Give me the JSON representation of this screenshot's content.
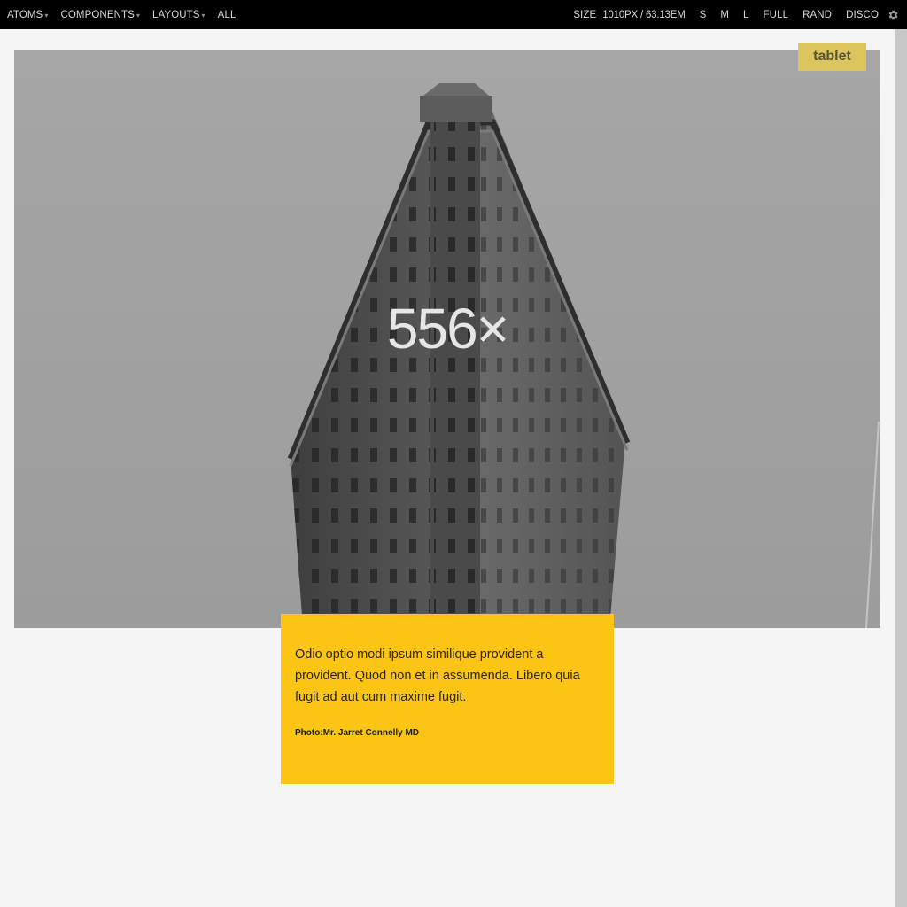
{
  "toolbar": {
    "nav": [
      {
        "label": "ATOMS",
        "caret": "▾"
      },
      {
        "label": "COMPONENTS",
        "caret": "▾"
      },
      {
        "label": "LAYOUTS",
        "caret": "▾"
      },
      {
        "label": "ALL",
        "caret": ""
      }
    ],
    "size_label": "SIZE",
    "size_value": "1010PX /  63.13EM",
    "size_buttons": [
      "S",
      "M",
      "L",
      "FULL",
      "RAND",
      "DISCO"
    ],
    "settings_icon": "gear-icon"
  },
  "viewport": {
    "breakpoint_badge": "tablet",
    "hero": {
      "placeholder_text": "556×",
      "image": "flatiron-building-photo"
    },
    "caption": {
      "body": "Odio optio modi ipsum similique provident a provident. Quod non et in assumenda. Libero quia fugit ad aut cum maxime fugit.",
      "credit": "Photo:Mr. Jarret Connelly MD"
    }
  },
  "colors": {
    "toolbar_bg": "#000000",
    "caption_bg": "#fcc515",
    "badge_bg": "#dcc55c",
    "page_bg": "#f5f5f5"
  }
}
